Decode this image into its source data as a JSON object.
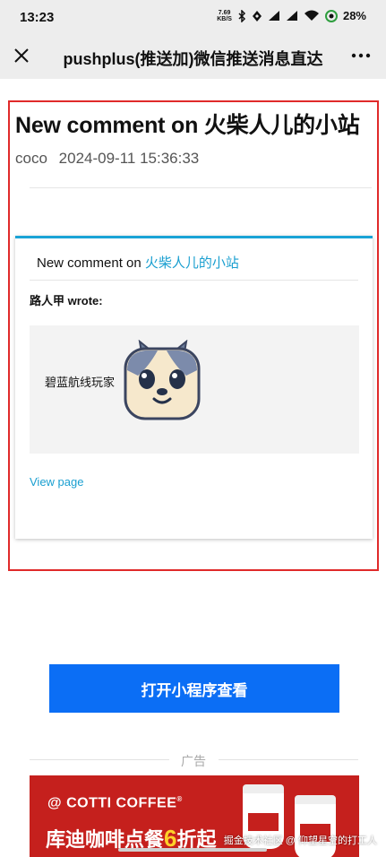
{
  "status_bar": {
    "time": "13:23",
    "net_speed_value": "7.69",
    "net_speed_unit": "KB/S",
    "battery": "28%"
  },
  "nav": {
    "close_icon": "close-icon",
    "title": "pushplus(推送加)微信推送消息直达",
    "more_icon": "more-icon"
  },
  "message": {
    "title": "New comment on 火柴人儿的小站",
    "author": "coco",
    "datetime": "2024-09-11 15:36:33"
  },
  "card": {
    "heading_prefix": "New comment on",
    "site_name": "火柴人儿的小站",
    "author_line": "路人甲 wrote:",
    "comment_text": "碧蓝航线玩家",
    "view_page_label": "View page"
  },
  "open_button_label": "打开小程序查看",
  "ad": {
    "label": "广告",
    "brand_symbol": "@",
    "brand": "COTTI COFFEE",
    "brand_reg": "®",
    "headline_before": "库迪咖啡点餐",
    "headline_number": "6",
    "headline_after": "折起"
  },
  "watermark": "掘金技术社区 @ 仰望星空的打工人",
  "colors": {
    "accent_blue": "#1a9fd0",
    "button_blue": "#0b6ef5",
    "highlight_red": "#e02a2a",
    "ad_red": "#c5201d"
  }
}
